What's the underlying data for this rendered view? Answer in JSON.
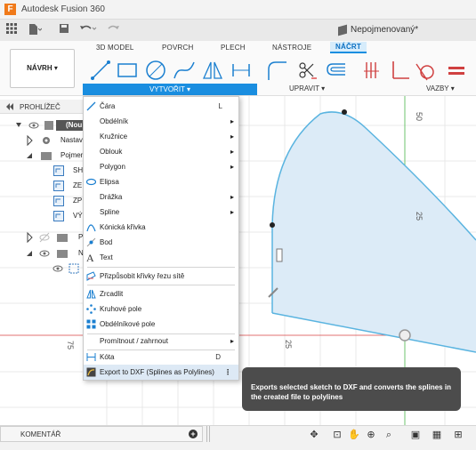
{
  "app": {
    "title": "Autodesk Fusion 360",
    "logo": "F"
  },
  "document": {
    "title": "Nepojmenovaný*"
  },
  "tabs": [
    {
      "label": "3D MODEL"
    },
    {
      "label": "POVRCH"
    },
    {
      "label": "PLECH"
    },
    {
      "label": "NÁSTROJE"
    },
    {
      "label": "NÁČRT"
    }
  ],
  "ribbon": {
    "workspace": "NÁVRH ▾",
    "groups": {
      "create": "VYTVOŘIT ▾",
      "modify": "UPRAVIT ▾",
      "constraints": "VAZBY ▾"
    }
  },
  "browser": {
    "title": "PROHLÍŽEČ",
    "items": [
      {
        "label": "(Nou"
      },
      {
        "label": "Nastav"
      },
      {
        "label": "Pojmen"
      },
      {
        "label": "SH"
      },
      {
        "label": "ZE"
      },
      {
        "label": "ZP"
      },
      {
        "label": "VÝ"
      },
      {
        "label": "P"
      },
      {
        "label": "N"
      }
    ]
  },
  "menu": {
    "items": [
      {
        "label": "Čára",
        "shortcut": "L",
        "icon": "line-icon"
      },
      {
        "label": "Obdélník",
        "submenu": "▸",
        "icon": "rectangle-icon"
      },
      {
        "label": "Kružnice",
        "submenu": "▸",
        "icon": "circle-icon"
      },
      {
        "label": "Oblouk",
        "submenu": "▸",
        "icon": "arc-icon"
      },
      {
        "label": "Polygon",
        "submenu": "▸",
        "icon": "polygon-icon"
      },
      {
        "label": "Elipsa",
        "icon": "ellipse-icon"
      },
      {
        "label": "Drážka",
        "submenu": "▸",
        "icon": "slot-icon"
      },
      {
        "label": "Spline",
        "submenu": "▸",
        "icon": "spline-icon"
      },
      {
        "label": "Kónická křivka",
        "icon": "conic-curve-icon"
      },
      {
        "label": "Bod",
        "icon": "point-icon"
      },
      {
        "label": "Text",
        "icon": "text-icon"
      },
      {
        "label": "Přizpůsobit křivky řezu sítě",
        "icon": "mesh-section-icon"
      },
      {
        "label": "Zrcadlit",
        "icon": "mirror-icon"
      },
      {
        "label": "Kruhové pole",
        "icon": "circular-pattern-icon"
      },
      {
        "label": "Obdélníkové pole",
        "icon": "rectangular-pattern-icon"
      },
      {
        "label": "Promítnout / zahrnout",
        "submenu": "▸"
      },
      {
        "label": "Kóta",
        "shortcut": "D",
        "icon": "dimension-icon"
      },
      {
        "label": "Export to DXF (Splines as Polylines)",
        "more": "⋮",
        "icon": "export-dxf-icon"
      }
    ]
  },
  "tooltip": {
    "text": "Exports selected sketch to DXF and converts the splines in the created file to polylines"
  },
  "canvas": {
    "dim_labels": [
      "50",
      "25",
      "75",
      "25"
    ]
  },
  "bottom": {
    "comments": "KOMENTÁŘ",
    "add": "+"
  },
  "colors": {
    "accent": "#1a8ee0",
    "profile_fill": "#dcebf7",
    "profile_stroke": "#5ab4e0",
    "axis_red": "#e05050",
    "axis_green": "#5ab85a"
  }
}
